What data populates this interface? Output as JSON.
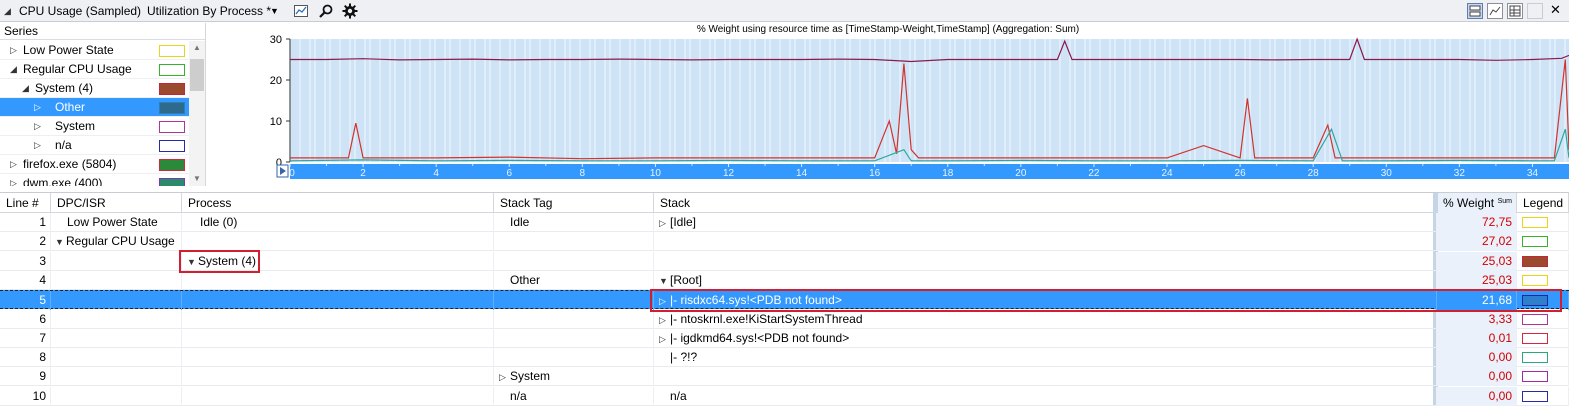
{
  "toolbar": {
    "title": "CPU Usage (Sampled)",
    "preset": "Utilization By Process *",
    "icons": [
      "collapse-triangle-icon",
      "dropdown-arrow-icon",
      "chart-settings-icon",
      "search-icon",
      "gear-icon",
      "graph-and-table-icon",
      "graph-only-icon",
      "table-only-icon",
      "close-icon"
    ]
  },
  "series": {
    "header": "Series",
    "items": [
      {
        "label": "Low Power State",
        "expander": "collapsed",
        "color": "#e8d51a",
        "fill": "#ffffff"
      },
      {
        "label": "Regular CPU Usage",
        "expander": "expanded",
        "color": "#36b22b",
        "fill": "#ffffff"
      },
      {
        "label": "System (4)",
        "expander": "expanded",
        "color": "#c0283a",
        "fill": "#9c4a2e"
      },
      {
        "label": "Other",
        "expander": "collapsed",
        "color": "#2f7fb3",
        "fill": "#2d6a8c"
      },
      {
        "label": "System",
        "expander": "collapsed",
        "color": "#b0339a",
        "fill": "#ffffff"
      },
      {
        "label": "n/a",
        "expander": "collapsed",
        "color": "#2a2aa6",
        "fill": "#ffffff"
      },
      {
        "label": "firefox.exe (5804)",
        "expander": "collapsed",
        "color": "#d8253b",
        "fill": "#2a8a3a"
      },
      {
        "label": "dwm.exe (400)",
        "expander": "collapsed",
        "color": "#7a39b8",
        "fill": "#2a8a6a"
      }
    ]
  },
  "chart_data": {
    "type": "line",
    "title": "% Weight using resource time as [TimeStamp-Weight,TimeStamp] (Aggregation: Sum)",
    "xlim": [
      0,
      35
    ],
    "ylim": [
      0,
      30
    ],
    "x_ticks": [
      "0",
      "2",
      "4",
      "6",
      "8",
      "10",
      "12",
      "14",
      "16",
      "18",
      "20",
      "22",
      "24",
      "26",
      "28",
      "30",
      "32",
      "34"
    ],
    "y_ticks": [
      "0",
      "10",
      "20",
      "30"
    ],
    "series": [
      {
        "color": "#8b1a4a",
        "x": [
          0,
          1,
          2,
          3,
          4,
          5,
          6,
          7,
          8,
          9,
          10,
          11,
          12,
          13,
          14,
          15,
          16,
          17,
          18,
          19,
          20,
          21,
          21.2,
          21.4,
          22,
          23,
          24,
          25,
          26,
          27,
          28,
          29,
          29.2,
          29.4,
          30,
          31,
          32,
          33,
          34,
          34.8,
          35
        ],
        "y": [
          25,
          25,
          25.2,
          24.9,
          25,
          25.1,
          24.9,
          25,
          25,
          25.1,
          25,
          24.9,
          25,
          25,
          25,
          25.1,
          25,
          24.5,
          25,
          25,
          25,
          25,
          29.5,
          25,
          25,
          25,
          25,
          25,
          25,
          24.9,
          25,
          25,
          30,
          25,
          25,
          25,
          25,
          24.8,
          25,
          25.3,
          26
        ]
      },
      {
        "color": "#d0342c",
        "x": [
          0,
          1.6,
          1.8,
          2,
          4,
          6,
          8,
          10,
          12,
          14,
          16,
          16.4,
          16.6,
          16.8,
          17,
          17.2,
          18,
          20,
          22,
          24,
          25,
          26,
          26.2,
          26.4,
          28,
          28.4,
          28.6,
          30,
          32,
          34,
          34.6,
          34.9,
          35
        ],
        "y": [
          1,
          1,
          9.5,
          1,
          1,
          1.2,
          0.8,
          1,
          1,
          1,
          1,
          10,
          2,
          24,
          3,
          1,
          1,
          1,
          1,
          1,
          4,
          1,
          15.5,
          1,
          1,
          9,
          1,
          1,
          1,
          1,
          1,
          25,
          3
        ]
      },
      {
        "color": "#2aa8a0",
        "x": [
          0,
          2,
          4,
          6,
          8,
          10,
          12,
          14,
          16,
          16.8,
          17,
          18,
          20,
          22,
          24,
          26,
          28,
          28.5,
          28.8,
          30,
          32,
          34,
          34.6,
          34.9,
          35
        ],
        "y": [
          0.3,
          0.5,
          0.3,
          0.4,
          0.3,
          0.3,
          0.4,
          0.3,
          0.3,
          3,
          0.3,
          0.3,
          0.4,
          0.3,
          0.3,
          0.4,
          0.3,
          8,
          0.3,
          0.3,
          0.4,
          0.3,
          0.3,
          8,
          1
        ]
      }
    ]
  },
  "table": {
    "columns": [
      "Line #",
      "DPC/ISR",
      "Process",
      "Stack Tag",
      "Stack",
      "% Weight",
      "Legend"
    ],
    "weight_sub": "Sum",
    "rows": [
      {
        "line": "1",
        "dpc": "Low Power State",
        "dpc_exp": "",
        "process": "Idle (0)",
        "proc_exp": "",
        "tag": "Idle",
        "tag_exp": "",
        "stack": "[Idle]",
        "stack_exp": "collapsed",
        "weight": "72,75",
        "color": "#e8d51a",
        "fill": "#ffffff"
      },
      {
        "line": "2",
        "dpc": "Regular CPU Usage",
        "dpc_exp": "expanded",
        "process": "",
        "proc_exp": "",
        "tag": "",
        "tag_exp": "",
        "stack": "",
        "stack_exp": "",
        "weight": "27,02",
        "color": "#36b22b",
        "fill": "#ffffff"
      },
      {
        "line": "3",
        "dpc": "",
        "dpc_exp": "",
        "process": "System (4)",
        "proc_exp": "expanded",
        "tag": "",
        "tag_exp": "",
        "stack": "",
        "stack_exp": "",
        "weight": "25,03",
        "color": "#c0283a",
        "fill": "#9c4a2e"
      },
      {
        "line": "4",
        "dpc": "",
        "dpc_exp": "",
        "process": "",
        "proc_exp": "",
        "tag": "Other",
        "tag_exp": "",
        "stack": "[Root]",
        "stack_exp": "expanded",
        "weight": "25,03",
        "color": "#e8d51a",
        "fill": "#ffffff"
      },
      {
        "line": "5",
        "dpc": "",
        "dpc_exp": "",
        "process": "",
        "proc_exp": "",
        "tag": "",
        "tag_exp": "",
        "stack": "|- risdxc64.sys!<PDB not found>",
        "stack_exp": "collapsed",
        "weight": "21,68",
        "color": "#1a2a9a",
        "fill": "#2f7fcf"
      },
      {
        "line": "6",
        "dpc": "",
        "dpc_exp": "",
        "process": "",
        "proc_exp": "",
        "tag": "",
        "tag_exp": "",
        "stack": "|- ntoskrnl.exe!KiStartSystemThread",
        "stack_exp": "collapsed",
        "weight": "3,33",
        "color": "#b0339a",
        "fill": "#ffffff"
      },
      {
        "line": "7",
        "dpc": "",
        "dpc_exp": "",
        "process": "",
        "proc_exp": "",
        "tag": "",
        "tag_exp": "",
        "stack": "|- igdkmd64.sys!<PDB not found>",
        "stack_exp": "collapsed",
        "weight": "0,01",
        "color": "#d8253b",
        "fill": "#ffffff"
      },
      {
        "line": "8",
        "dpc": "",
        "dpc_exp": "",
        "process": "",
        "proc_exp": "",
        "tag": "",
        "tag_exp": "",
        "stack": "|- ?!?",
        "stack_exp": "",
        "weight": "0,00",
        "color": "#2aa877",
        "fill": "#ffffff"
      },
      {
        "line": "9",
        "dpc": "",
        "dpc_exp": "",
        "process": "",
        "proc_exp": "",
        "tag": "System",
        "tag_exp": "collapsed",
        "stack": "",
        "stack_exp": "",
        "weight": "0,00",
        "color": "#a02aa8",
        "fill": "#ffffff"
      },
      {
        "line": "10",
        "dpc": "",
        "dpc_exp": "",
        "process": "",
        "proc_exp": "",
        "tag": "n/a",
        "tag_exp": "",
        "stack": "n/a",
        "stack_exp": "",
        "weight": "0,00",
        "color": "#2a2aa6",
        "fill": "#ffffff"
      }
    ]
  }
}
